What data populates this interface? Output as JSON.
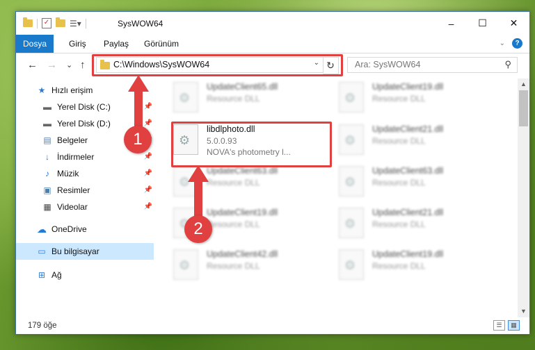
{
  "window": {
    "title": "SysWOW64",
    "controls": [
      "–",
      "☐",
      "✕"
    ]
  },
  "ribbon": {
    "tabs": [
      "Dosya",
      "Giriş",
      "Paylaş",
      "Görünüm"
    ],
    "active_tab": "Dosya",
    "accent": "#1979ca"
  },
  "nav": {
    "back": "←",
    "forward": "→",
    "recent": "⌄",
    "up": "↑",
    "address": "C:\\Windows\\SysWOW64",
    "refresh": "↻",
    "search_placeholder": "Ara: SysWOW64"
  },
  "sidebar": {
    "items": [
      {
        "label": "Hızlı erişim",
        "icon": "star-icon",
        "glyph": "★"
      },
      {
        "label": "Yerel Disk (C:)",
        "icon": "drive-icon",
        "glyph": "▬",
        "pinned": true
      },
      {
        "label": "Yerel Disk (D:)",
        "icon": "drive-icon",
        "glyph": "▬",
        "pinned": true
      },
      {
        "label": "Belgeler",
        "icon": "documents-icon",
        "glyph": "▤",
        "pinned": true
      },
      {
        "label": "İndirmeler",
        "icon": "download-icon",
        "glyph": "↓",
        "pinned": true
      },
      {
        "label": "Müzik",
        "icon": "music-icon",
        "glyph": "♪",
        "pinned": true
      },
      {
        "label": "Resimler",
        "icon": "pictures-icon",
        "glyph": "▣",
        "pinned": true
      },
      {
        "label": "Videolar",
        "icon": "videos-icon",
        "glyph": "▦",
        "pinned": true
      },
      {
        "label": "OneDrive",
        "icon": "cloud-icon",
        "glyph": "☁"
      },
      {
        "label": "Bu bilgisayar",
        "icon": "computer-icon",
        "glyph": "▭",
        "selected": true
      },
      {
        "label": "Ağ",
        "icon": "network-icon",
        "glyph": "⊞"
      }
    ]
  },
  "files": {
    "left": [
      {
        "name": "UpdateClient65.dll",
        "type": "Resource DLL",
        "blurred": true
      },
      {
        "name": "libdlphoto.dll",
        "version": "5.0.0.93",
        "desc": "NOVA's photometry l...",
        "blurred": false
      },
      {
        "name": "UpdateClient63.dll",
        "type": "Resource DLL",
        "blurred": true
      },
      {
        "name": "UpdateClient19.dll",
        "type": "Resource DLL",
        "blurred": true
      },
      {
        "name": "UpdateClient42.dll",
        "type": "Resource DLL",
        "blurred": true
      }
    ],
    "right": [
      {
        "name": "UpdateClient19.dll",
        "type": "Resource DLL",
        "blurred": true
      },
      {
        "name": "UpdateClient21.dll",
        "type": "Resource DLL",
        "blurred": true
      },
      {
        "name": "UpdateClient63.dll",
        "type": "Resource DLL",
        "blurred": true
      },
      {
        "name": "UpdateClient21.dll",
        "type": "Resource DLL",
        "blurred": true
      },
      {
        "name": "UpdateClient19.dll",
        "type": "Resource DLL",
        "blurred": true
      }
    ]
  },
  "status": {
    "item_count": "179 öğe"
  },
  "annotations": {
    "badge_1": "1",
    "badge_2": "2",
    "color": "#e0403f"
  }
}
